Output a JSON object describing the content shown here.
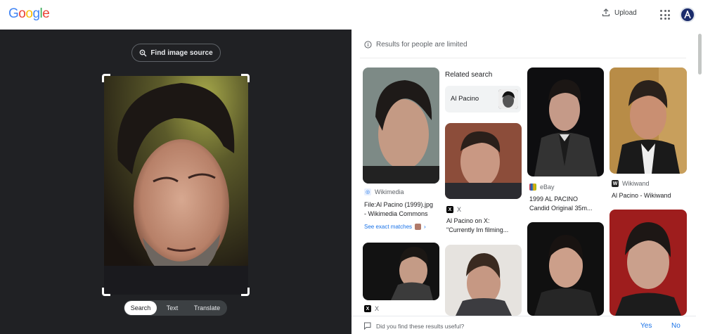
{
  "header": {
    "logo_letters": [
      {
        "ch": "G",
        "color": "#4285F4"
      },
      {
        "ch": "o",
        "color": "#EA4335"
      },
      {
        "ch": "o",
        "color": "#FBBC05"
      },
      {
        "ch": "g",
        "color": "#4285F4"
      },
      {
        "ch": "l",
        "color": "#34A853"
      },
      {
        "ch": "e",
        "color": "#EA4335"
      }
    ],
    "upload_label": "Upload",
    "upload_icon": "upload-icon",
    "apps_icon": "apps-grid-icon",
    "avatar_icon": "account-avatar"
  },
  "left_panel": {
    "find_source_label": "Find image source",
    "find_source_icon": "lens-search-icon",
    "modes": [
      "Search",
      "Text",
      "Translate"
    ],
    "active_mode": "Search"
  },
  "results": {
    "notice": "Results for people are limited",
    "notice_icon": "info-icon",
    "related_heading": "Related search",
    "related_chip_label": "Al Pacino",
    "cards": [
      {
        "source": "Wikimedia",
        "source_icon": "wikimedia-icon",
        "title_line1": "File:Al Pacino (1999).jpg",
        "title_line2": "- Wikimedia Commons",
        "exact_label": "See exact matches"
      },
      {
        "source": "X",
        "source_icon": "x-icon",
        "title_line1": "Al Pacino on X:",
        "title_line2": "\"Currently Im filming..."
      },
      {
        "source": "eBay",
        "source_icon": "ebay-icon",
        "title_line1": "1999 AL PACINO",
        "title_line2": "Candid Original 35m..."
      },
      {
        "source": "Wikiwand",
        "source_icon": "wikiwand-icon",
        "title_line1": "Al Pacino - Wikiwand",
        "title_line2": ""
      },
      {
        "source": "X",
        "source_icon": "x-icon",
        "title_line1": "",
        "title_line2": ""
      }
    ]
  },
  "feedback": {
    "question": "Did you find these results useful?",
    "yes_label": "Yes",
    "no_label": "No",
    "feedback_icon": "feedback-icon"
  },
  "colors": {
    "left_bg": "#202124",
    "link_blue": "#1a73e8"
  }
}
